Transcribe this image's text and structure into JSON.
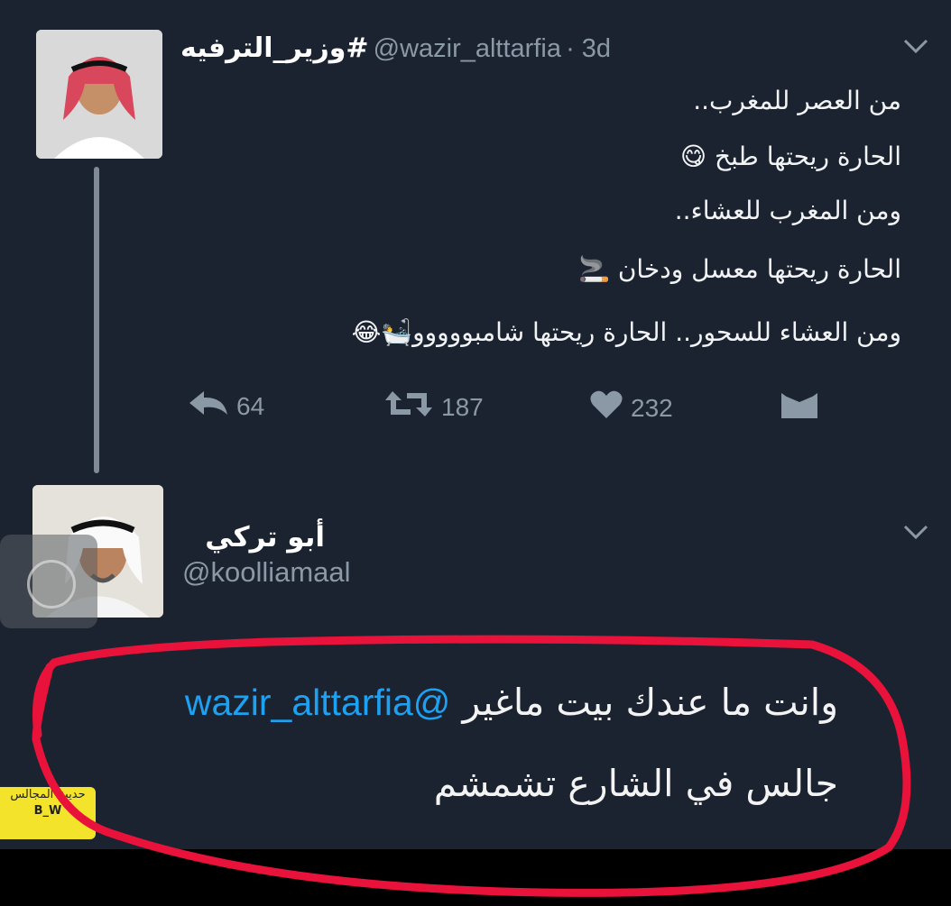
{
  "tweet": {
    "display_name": "#وزير_الترفيه",
    "handle": "@wazir_alttarfia",
    "time": "· 3d",
    "lines": [
      "من العصر للمغرب..",
      "الحارة ريحتها طبخ 😋",
      "ومن المغرب للعشاء..",
      "الحارة ريحتها معسل ودخان 🚬",
      "ومن العشاء للسحور.. الحارة ريحتها شامبووووو🛀😂"
    ],
    "actions": {
      "replies": "64",
      "retweets": "187",
      "likes": "232"
    }
  },
  "reply": {
    "display_name": "أبو تركي",
    "handle": "@koolliamaal",
    "mention": "@wazir_alttarfia",
    "line1_text": "وانت ما عندك بيت ماغير",
    "line2_text": "جالس في الشارع تشمشم"
  },
  "watermark": {
    "text_top": "حديث المجالس",
    "text_bottom": "B_W"
  },
  "colors": {
    "background": "#1b2330",
    "accent": "#1da1f2",
    "highlight": "#e8123a"
  },
  "icons": {
    "reply": "reply-icon",
    "retweet": "retweet-icon",
    "like": "heart-icon",
    "dm": "envelope-icon",
    "menu": "chevron-down-icon"
  }
}
